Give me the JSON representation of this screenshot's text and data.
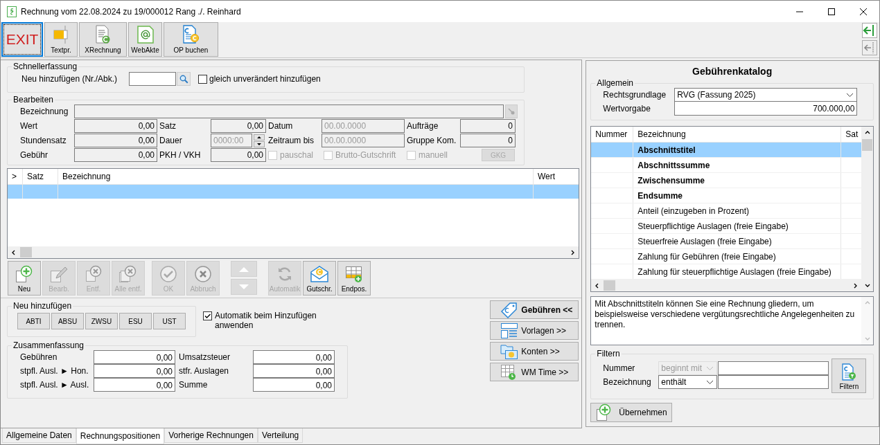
{
  "window": {
    "title": "Rechnung vom 22.08.2024 zu 19/000012 Rang ./. Reinhard"
  },
  "toolbar": [
    {
      "label": "EXIT",
      "kind": "exit",
      "focused": true
    },
    {
      "label": "Textpr.",
      "kind": "text",
      "focused": false
    },
    {
      "label": "XRechnung",
      "kind": "xrechnung",
      "focused": false
    },
    {
      "label": "WebAkte",
      "kind": "webakte",
      "focused": false
    },
    {
      "label": "OP buchen",
      "kind": "booking",
      "focused": false
    }
  ],
  "quick_entry": {
    "title": "Schnellerfassung",
    "label": "Neu hinzufügen (Nr./Abk.)",
    "checkbox": {
      "label": "gleich unverändert hinzufügen",
      "checked": false
    }
  },
  "edit": {
    "title": "Bearbeiten",
    "description_label": "Bezeichnung",
    "rows": [
      {
        "cells": [
          {
            "label": "Wert",
            "value": "0,00",
            "kind": "amount"
          },
          {
            "label": "Satz",
            "value": "0,00",
            "kind": "amount"
          },
          {
            "label": "Datum",
            "value": "00.00.0000",
            "kind": "date"
          },
          {
            "label": "Aufträge",
            "value": "0",
            "kind": "amount"
          }
        ]
      },
      {
        "cells": [
          {
            "label": "Stundensatz",
            "value": "0,00",
            "kind": "amount"
          },
          {
            "label": "Dauer",
            "value": "0000:00",
            "kind": "time"
          },
          {
            "label": "Zeitraum bis",
            "value": "00.00.0000",
            "kind": "date"
          },
          {
            "label": "Gruppe Kom.",
            "value": "0",
            "kind": "amount"
          }
        ]
      },
      {
        "cells": [
          {
            "label": "Gebühr",
            "value": "0,00",
            "kind": "amount"
          },
          {
            "label": "PKH / VKH",
            "value": "0,00",
            "kind": "amount"
          }
        ]
      }
    ],
    "options": [
      {
        "label": "pauschal",
        "checked": false,
        "disabled": true
      },
      {
        "label": "Brutto-Gutschrift",
        "checked": false,
        "disabled": true
      },
      {
        "label": "manuell",
        "checked": false,
        "disabled": true
      }
    ],
    "gkg_button": {
      "label": "GKG",
      "disabled": true
    }
  },
  "positions": {
    "columns": [
      ">",
      "Satz",
      "Bezeichnung",
      "Wert"
    ],
    "rows": [
      {
        "selected": true
      }
    ]
  },
  "action_groups": [
    {
      "kind": "buttons",
      "buttons": [
        {
          "label": "Neu",
          "kind": "new",
          "disabled": false
        },
        {
          "label": "Bearb.",
          "kind": "edit",
          "disabled": true
        },
        {
          "label": "Entf.",
          "kind": "delete",
          "disabled": true
        },
        {
          "label": "Alle entf.",
          "kind": "delete_all",
          "disabled": true
        }
      ]
    },
    {
      "kind": "buttons",
      "buttons": [
        {
          "label": "OK",
          "kind": "ok",
          "disabled": true
        },
        {
          "label": "Abbruch",
          "kind": "cancel",
          "disabled": true
        }
      ]
    },
    {
      "kind": "arrows",
      "buttons": [
        {
          "kind": "up",
          "disabled": true
        },
        {
          "kind": "down",
          "disabled": true
        }
      ]
    },
    {
      "kind": "buttons",
      "buttons": [
        {
          "label": "Automatik",
          "kind": "refresh",
          "disabled": true
        },
        {
          "label": "Gutschr.",
          "kind": "credit",
          "disabled": false
        },
        {
          "label": "Endpos.",
          "kind": "endpos",
          "disabled": false
        }
      ]
    }
  ],
  "add_new": {
    "title": "Neu hinzufügen",
    "buttons": [
      "ABTI",
      "ABSU",
      "ZWSU",
      "ESU",
      "UST"
    ],
    "checkbox": {
      "label": "Automatik beim Hinzufügen anwenden",
      "checked": true
    }
  },
  "summary": {
    "title": "Zusammenfassung",
    "rows": [
      [
        {
          "label": "Gebühren",
          "value": "0,00"
        },
        {
          "label": "Umsatzsteuer",
          "value": "0,00"
        }
      ],
      [
        {
          "label": "stpfl. Ausl. ► Hon.",
          "value": "0,00"
        },
        {
          "label": "stfr. Auslagen",
          "value": "0,00"
        }
      ],
      [
        {
          "label": "stpfl. Ausl. ► Ausl.",
          "value": "0,00"
        },
        {
          "label": "Summe",
          "value": "0,00"
        }
      ]
    ]
  },
  "side_buttons": [
    {
      "label": "Gebühren <<",
      "kind": "tag",
      "selected": true
    },
    {
      "label": "Vorlagen >>",
      "kind": "layout",
      "selected": false
    },
    {
      "label": "Konten >>",
      "kind": "folders",
      "selected": false
    },
    {
      "label": "WM Time >>",
      "kind": "time",
      "selected": false
    }
  ],
  "tabs": [
    {
      "label": "Allgemeine Daten",
      "selected": false
    },
    {
      "label": "Rechnungspositionen",
      "selected": true
    },
    {
      "label": "Vorherige Rechnungen",
      "selected": false
    },
    {
      "label": "Verteilung",
      "selected": false
    }
  ],
  "catalog": {
    "title": "Gebührenkatalog",
    "general": {
      "title": "Allgemein",
      "basis_label": "Rechtsgrundlage",
      "basis": "RVG (Fassung 2025)",
      "value_label": "Wertvorgabe",
      "value": "700.000,00"
    },
    "columns": [
      "Nummer",
      "Bezeichnung",
      "Sat"
    ],
    "rows": [
      {
        "name": "Abschnittstitel",
        "bold": true,
        "selected": true
      },
      {
        "name": "Abschnittssumme",
        "bold": true,
        "selected": false
      },
      {
        "name": "Zwischensumme",
        "bold": true,
        "selected": false
      },
      {
        "name": "Endsumme",
        "bold": true,
        "selected": false
      },
      {
        "name": "Anteil (einzugeben in Prozent)",
        "bold": false,
        "selected": false
      },
      {
        "name": "Steuerpflichtige Auslagen (freie Eingabe)",
        "bold": false,
        "selected": false
      },
      {
        "name": "Steuerfreie Auslagen (freie Eingabe)",
        "bold": false,
        "selected": false
      },
      {
        "name": "Zahlung für Gebühren (freie Eingabe)",
        "bold": false,
        "selected": false
      },
      {
        "name": "Zahlung für steuerpflichtige Auslagen (freie Eingabe)",
        "bold": false,
        "selected": false
      }
    ],
    "description": "Mit Abschnittstiteln können Sie eine Rechnung gliedern, um beispielsweise verschiedene vergütungsrechtliche Angelegenheiten zu trennen.",
    "filter": {
      "title": "Filtern",
      "rows": [
        {
          "label": "Nummer",
          "mode": "beginnt mit",
          "disabled": true
        },
        {
          "label": "Bezeichnung",
          "mode": "enthält",
          "disabled": false
        }
      ],
      "button": "Filtern"
    },
    "apply_button": "Übernehmen"
  }
}
